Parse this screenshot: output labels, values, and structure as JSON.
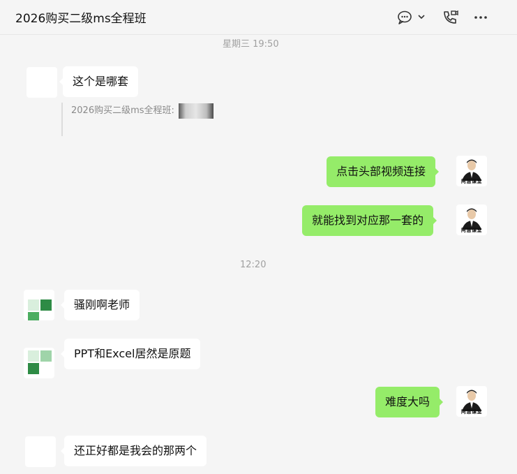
{
  "header": {
    "title": "2026购买二级ms全程班",
    "icons": [
      "chat-dropdown-icon",
      "video-call-icon",
      "more-icon"
    ]
  },
  "timestamps": [
    "星期三 19:50",
    "12:20"
  ],
  "messages": [
    {
      "side": "in",
      "text": "这个是哪套",
      "avatar": "blank"
    },
    {
      "side": "out",
      "text": "点击头部视频连接",
      "avatar": "teacher"
    },
    {
      "side": "out",
      "text": "就能找到对应那一套的",
      "avatar": "teacher"
    },
    {
      "side": "in",
      "text": "骚刚啊老师",
      "avatar": "green"
    },
    {
      "side": "in",
      "text": "PPT和Excel居然是原题",
      "avatar": "green"
    },
    {
      "side": "out",
      "text": "难度大吗",
      "avatar": "teacher"
    },
    {
      "side": "in",
      "text": "还正好都是我会的那两个",
      "avatar": "blank"
    }
  ],
  "quote": {
    "label": "2026购买二级ms全程班:"
  },
  "avatar_caption": "阿慧课堂",
  "colors": {
    "outgoing_bubble": "#95ec69",
    "incoming_bubble": "#ffffff",
    "background": "#f5f5f5"
  }
}
